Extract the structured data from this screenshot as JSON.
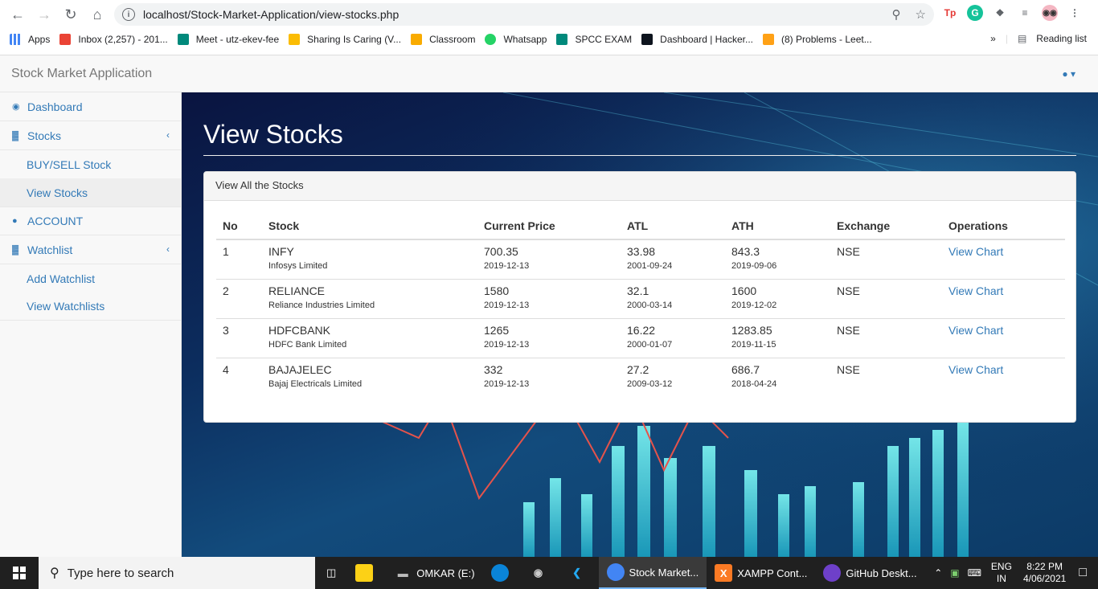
{
  "browser": {
    "url": "localhost/Stock-Market-Application/view-stocks.php",
    "bookmarks": [
      {
        "label": "Apps",
        "color": "#4285f4"
      },
      {
        "label": "Inbox (2,257) - 201...",
        "color": "#ea4335"
      },
      {
        "label": "Meet - utz-ekev-fee",
        "color": "#00897b"
      },
      {
        "label": "Sharing Is Caring (V...",
        "color": "#fbbc04"
      },
      {
        "label": "Classroom",
        "color": "#f9ab00"
      },
      {
        "label": "Whatsapp",
        "color": "#25d366"
      },
      {
        "label": "SPCC EXAM",
        "color": "#00897b"
      },
      {
        "label": "Dashboard | Hacker...",
        "color": "#0e141e"
      },
      {
        "label": "(8) Problems - Leet...",
        "color": "#ffa116"
      }
    ],
    "more_bookmarks": "»",
    "reading_list": "Reading list"
  },
  "app": {
    "brand": "Stock Market Application",
    "sidebar": {
      "dashboard": "Dashboard",
      "stocks": "Stocks",
      "buy_sell": "BUY/SELL Stock",
      "view_stocks": "View Stocks",
      "account": "ACCOUNT",
      "watchlist": "Watchlist",
      "add_watchlist": "Add Watchlist",
      "view_watchlists": "View Watchlists"
    },
    "page_title": "View Stocks",
    "panel_heading": "View All the Stocks",
    "table": {
      "headers": [
        "No",
        "Stock",
        "Current Price",
        "ATL",
        "ATH",
        "Exchange",
        "Operations"
      ],
      "rows": [
        {
          "no": "1",
          "symbol": "INFY",
          "name": "Infosys Limited",
          "price": "700.35",
          "price_date": "2019-12-13",
          "atl": "33.98",
          "atl_date": "2001-09-24",
          "ath": "843.3",
          "ath_date": "2019-09-06",
          "exchange": "NSE",
          "op": "View Chart"
        },
        {
          "no": "2",
          "symbol": "RELIANCE",
          "name": "Reliance Industries Limited",
          "price": "1580",
          "price_date": "2019-12-13",
          "atl": "32.1",
          "atl_date": "2000-03-14",
          "ath": "1600",
          "ath_date": "2019-12-02",
          "exchange": "NSE",
          "op": "View Chart"
        },
        {
          "no": "3",
          "symbol": "HDFCBANK",
          "name": "HDFC Bank Limited",
          "price": "1265",
          "price_date": "2019-12-13",
          "atl": "16.22",
          "atl_date": "2000-01-07",
          "ath": "1283.85",
          "ath_date": "2019-11-15",
          "exchange": "NSE",
          "op": "View Chart"
        },
        {
          "no": "4",
          "symbol": "BAJAJELEC",
          "name": "Bajaj Electricals Limited",
          "price": "332",
          "price_date": "2019-12-13",
          "atl": "27.2",
          "atl_date": "2009-03-12",
          "ath": "686.7",
          "ath_date": "2018-04-24",
          "exchange": "NSE",
          "op": "View Chart"
        }
      ]
    }
  },
  "taskbar": {
    "search_placeholder": "Type here to search",
    "items": [
      {
        "label": "OMKAR (E:)",
        "color": "#bbbbbb"
      },
      {
        "label": "Stock Market...",
        "color": "#4285f4",
        "active": true
      },
      {
        "label": "XAMPP Cont...",
        "color": "#fb7a24"
      },
      {
        "label": "GitHub Deskt...",
        "color": "#6e40c9"
      }
    ],
    "lang": "ENG",
    "region": "IN",
    "time": "8:22 PM",
    "date": "4/06/2021"
  }
}
